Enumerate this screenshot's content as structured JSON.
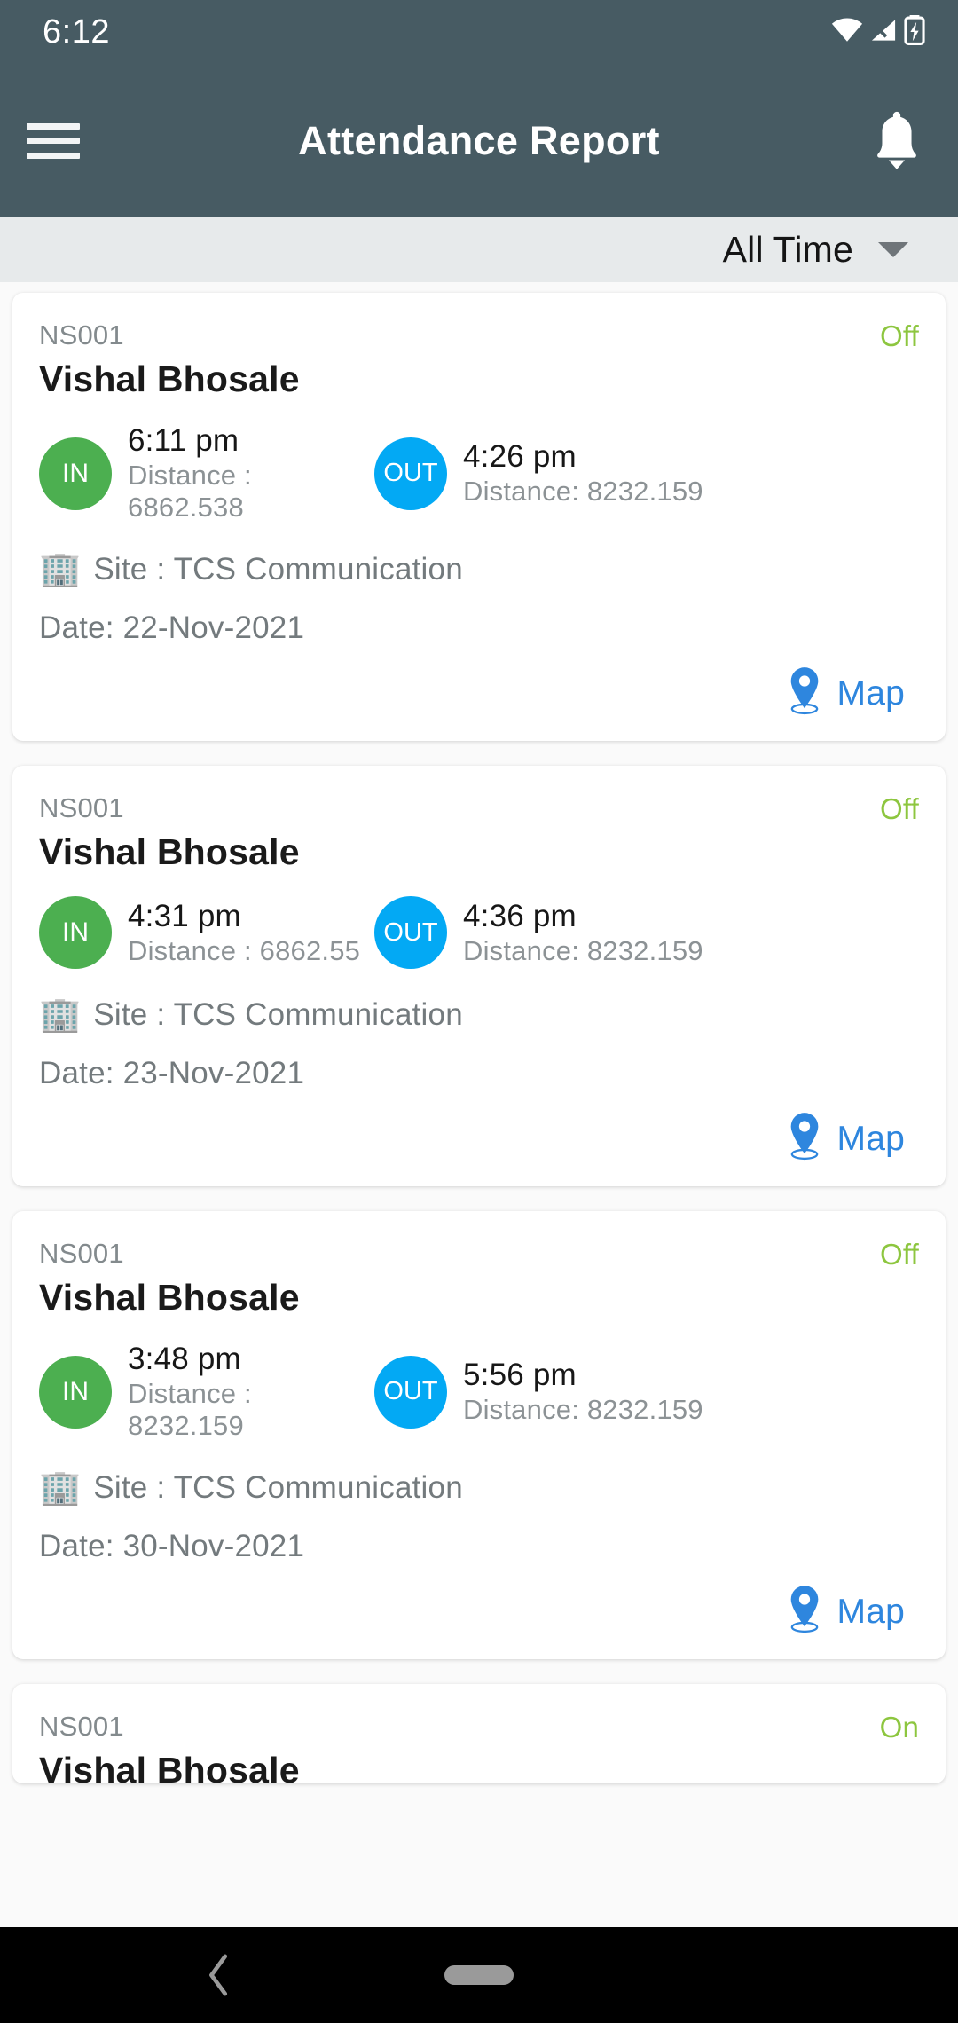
{
  "status_bar": {
    "clock": "6:12",
    "icons": [
      "wifi-icon",
      "cellular-signal-off-icon",
      "battery-charging-icon"
    ]
  },
  "app_bar": {
    "menu_icon": "hamburger-menu-icon",
    "title": "Attendance Report",
    "notification_icon": "bell-icon",
    "background_color": "#475b63"
  },
  "filter": {
    "value": "All Time",
    "caret_icon": "chevron-down-icon"
  },
  "labels": {
    "map": "Map",
    "site_icon": "🏢",
    "map_pin_icon": "map-pin-icon",
    "in_badge": "IN",
    "out_badge": "OUT"
  },
  "colors": {
    "in_badge": "#4caf50",
    "out_badge": "#03a9f4",
    "status_text": "#8dc63f",
    "map_link": "#2e86de",
    "app_bar": "#475b63"
  },
  "records": [
    {
      "code": "NS001",
      "status": "Off",
      "name": "Vishal Bhosale",
      "in_time": "6:11 pm",
      "in_distance": "Distance : 6862.538",
      "out_time": "4:26 pm",
      "out_distance": "Distance: 8232.159",
      "site": "Site : TCS Communication",
      "date": "Date: 22-Nov-2021",
      "map": "Map"
    },
    {
      "code": "NS001",
      "status": "Off",
      "name": "Vishal Bhosale",
      "in_time": "4:31 pm",
      "in_distance": "Distance : 6862.55",
      "out_time": "4:36 pm",
      "out_distance": "Distance: 8232.159",
      "site": "Site : TCS Communication",
      "date": "Date: 23-Nov-2021",
      "map": "Map"
    },
    {
      "code": "NS001",
      "status": "Off",
      "name": "Vishal Bhosale",
      "in_time": "3:48 pm",
      "in_distance": "Distance : 8232.159",
      "out_time": "5:56 pm",
      "out_distance": "Distance: 8232.159",
      "site": "Site : TCS Communication",
      "date": "Date: 30-Nov-2021",
      "map": "Map"
    },
    {
      "code": "NS001",
      "status": "On",
      "name": "Vishal Bhosale"
    }
  ],
  "nav_bar": {
    "back_icon": "back-chevron-icon",
    "home_icon": "home-pill-icon"
  }
}
